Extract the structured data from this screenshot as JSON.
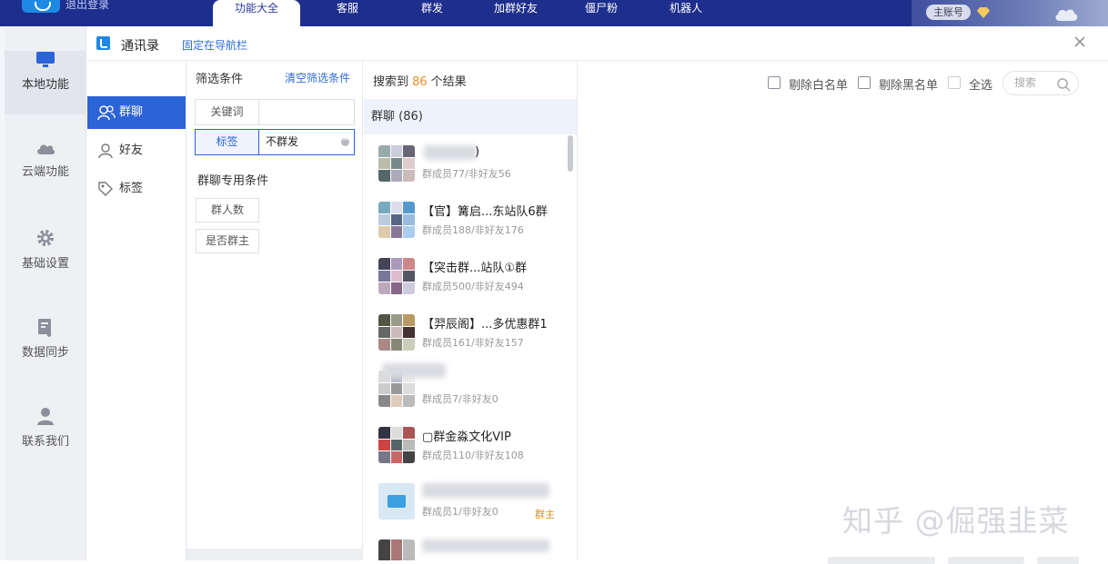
{
  "topbar": {
    "logout_label": "退出登录",
    "tabs": [
      "功能大全",
      "客服",
      "群发",
      "加群好友",
      "僵尸粉",
      "机器人"
    ],
    "account_label": "主账号",
    "icons": [
      "logo-icon",
      "diamond-icon",
      "cloud-icon"
    ]
  },
  "leftnav": {
    "items": [
      {
        "label": "本地功能",
        "icon": "monitor-icon",
        "active": true
      },
      {
        "label": "云端功能",
        "icon": "cloud-icon"
      },
      {
        "label": "基础设置",
        "icon": "gear-icon"
      },
      {
        "label": "数据同步",
        "icon": "sync-icon"
      },
      {
        "label": "联系我们",
        "icon": "person-icon"
      }
    ]
  },
  "titlebar": {
    "title": "通讯录",
    "pin_label": "固定在导航栏"
  },
  "categories": [
    {
      "label": "群聊",
      "icon": "group-icon",
      "active": true
    },
    {
      "label": "好友",
      "icon": "user-icon"
    },
    {
      "label": "标签",
      "icon": "tag-icon"
    }
  ],
  "filter": {
    "title": "筛选条件",
    "clear_label": "清空筛选条件",
    "keyword_label": "关键词",
    "keyword_value": "",
    "tag_label": "标签",
    "tag_value": "不群发",
    "group_conditions_title": "群聊专用条件",
    "group_size_label": "群人数",
    "is_owner_label": "是否群主"
  },
  "results": {
    "prefix": "搜索到",
    "count": "86",
    "suffix": "个结果",
    "group_header": "群聊 (86)",
    "items": [
      {
        "name": ")",
        "sub": "群成员77/非好友56"
      },
      {
        "name": "【官】篝启...东站队6群",
        "sub": "群成员188/非好友176"
      },
      {
        "name": "【突击群...站队①群",
        "sub": "群成员500/非好友494"
      },
      {
        "name": "【羿辰阁】...多优惠群1",
        "sub": "群成员161/非好友157"
      },
      {
        "name": "",
        "sub": "群成员7/非好友0"
      },
      {
        "name": "▢群金淼文化VIP",
        "sub": "群成员110/非好友108"
      },
      {
        "name": "",
        "sub": "群成员1/非好友0",
        "owner": "群主"
      }
    ]
  },
  "right": {
    "remove_whitelist": "剔除白名单",
    "remove_blacklist": "剔除黑名单",
    "select_all": "全选",
    "search_placeholder": "搜索"
  },
  "watermark": "知乎 @倔强韭菜"
}
